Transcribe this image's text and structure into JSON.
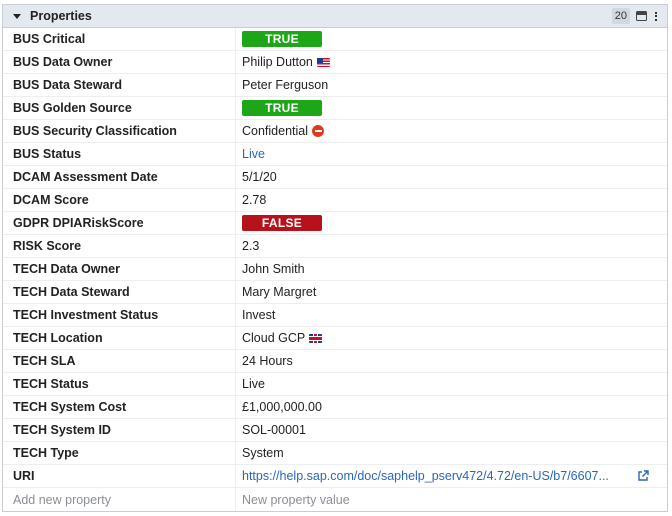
{
  "panel": {
    "title": "Properties",
    "count": "20"
  },
  "properties": [
    {
      "key": "BUS Critical",
      "value": "TRUE",
      "type": "pill-true"
    },
    {
      "key": "BUS Data Owner",
      "value": "Philip Dutton",
      "type": "flag-us"
    },
    {
      "key": "BUS Data Steward",
      "value": "Peter Ferguson",
      "type": "text"
    },
    {
      "key": "BUS Golden Source",
      "value": "TRUE",
      "type": "pill-true"
    },
    {
      "key": "BUS Security Classification",
      "value": "Confidential",
      "type": "no-entry"
    },
    {
      "key": "BUS Status",
      "value": "Live",
      "type": "link"
    },
    {
      "key": "DCAM Assessment Date",
      "value": "5/1/20",
      "type": "text"
    },
    {
      "key": "DCAM Score",
      "value": "2.78",
      "type": "text"
    },
    {
      "key": "GDPR DPIARiskScore",
      "value": "FALSE",
      "type": "pill-false"
    },
    {
      "key": "RISK Score",
      "value": "2.3",
      "type": "text"
    },
    {
      "key": "TECH Data Owner",
      "value": "John Smith",
      "type": "text"
    },
    {
      "key": "TECH Data Steward",
      "value": "Mary Margret",
      "type": "text"
    },
    {
      "key": "TECH Investment Status",
      "value": "Invest",
      "type": "text"
    },
    {
      "key": "TECH Location",
      "value": "Cloud GCP",
      "type": "flag-uk"
    },
    {
      "key": "TECH SLA",
      "value": "24 Hours",
      "type": "text"
    },
    {
      "key": "TECH Status",
      "value": "Live",
      "type": "text"
    },
    {
      "key": "TECH System Cost",
      "value": "£1,000,000.00",
      "type": "text"
    },
    {
      "key": "TECH System ID",
      "value": "SOL-00001",
      "type": "text"
    },
    {
      "key": "TECH Type",
      "value": "System",
      "type": "text"
    },
    {
      "key": "URI",
      "value": "https://help.sap.com/doc/saphelp_pserv472/4.72/en-US/b7/6607...",
      "type": "uri"
    }
  ],
  "add_row": {
    "key_placeholder": "Add new property",
    "value_placeholder": "New property value"
  },
  "colors": {
    "true_pill": "#1ea619",
    "false_pill": "#b5121b",
    "link": "#2868b9",
    "header_bg": "#e4e8ef"
  },
  "icons": {
    "collapse": "caret-down-icon",
    "minimize": "minimize-panel-icon",
    "menu": "kebab-menu-icon",
    "external": "external-link-icon"
  }
}
